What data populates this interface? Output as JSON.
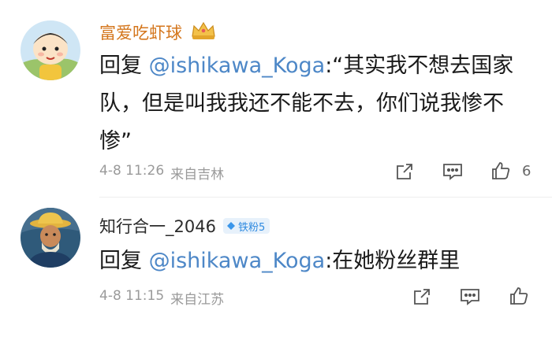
{
  "comments": [
    {
      "username": "富爱吃虾球",
      "reply_prefix": "回复 ",
      "mention": "@ishikawa_Koga",
      "text": ":“其实我不想去国家队，但是叫我我还不能不去，你们说我惨不惨”",
      "date": "4-8 11:26",
      "source": "来自吉林",
      "likes": "6",
      "name_color": "#d4761c"
    },
    {
      "username": "知行合一_2046",
      "badge": "铁粉5",
      "reply_prefix": "回复 ",
      "mention": "@ishikawa_Koga",
      "text": ":在她粉丝群里",
      "date": "4-8 11:15",
      "source": "来自江苏",
      "name_color": "#2b2b2b"
    }
  ],
  "icons": [
    "share-icon",
    "comment-icon",
    "like-icon",
    "crown-badge-icon",
    "fan-diamond-icon"
  ],
  "colors": {
    "mention": "#4d87c7",
    "meta": "#9a9a9a",
    "badge": "#2f8ae0"
  }
}
